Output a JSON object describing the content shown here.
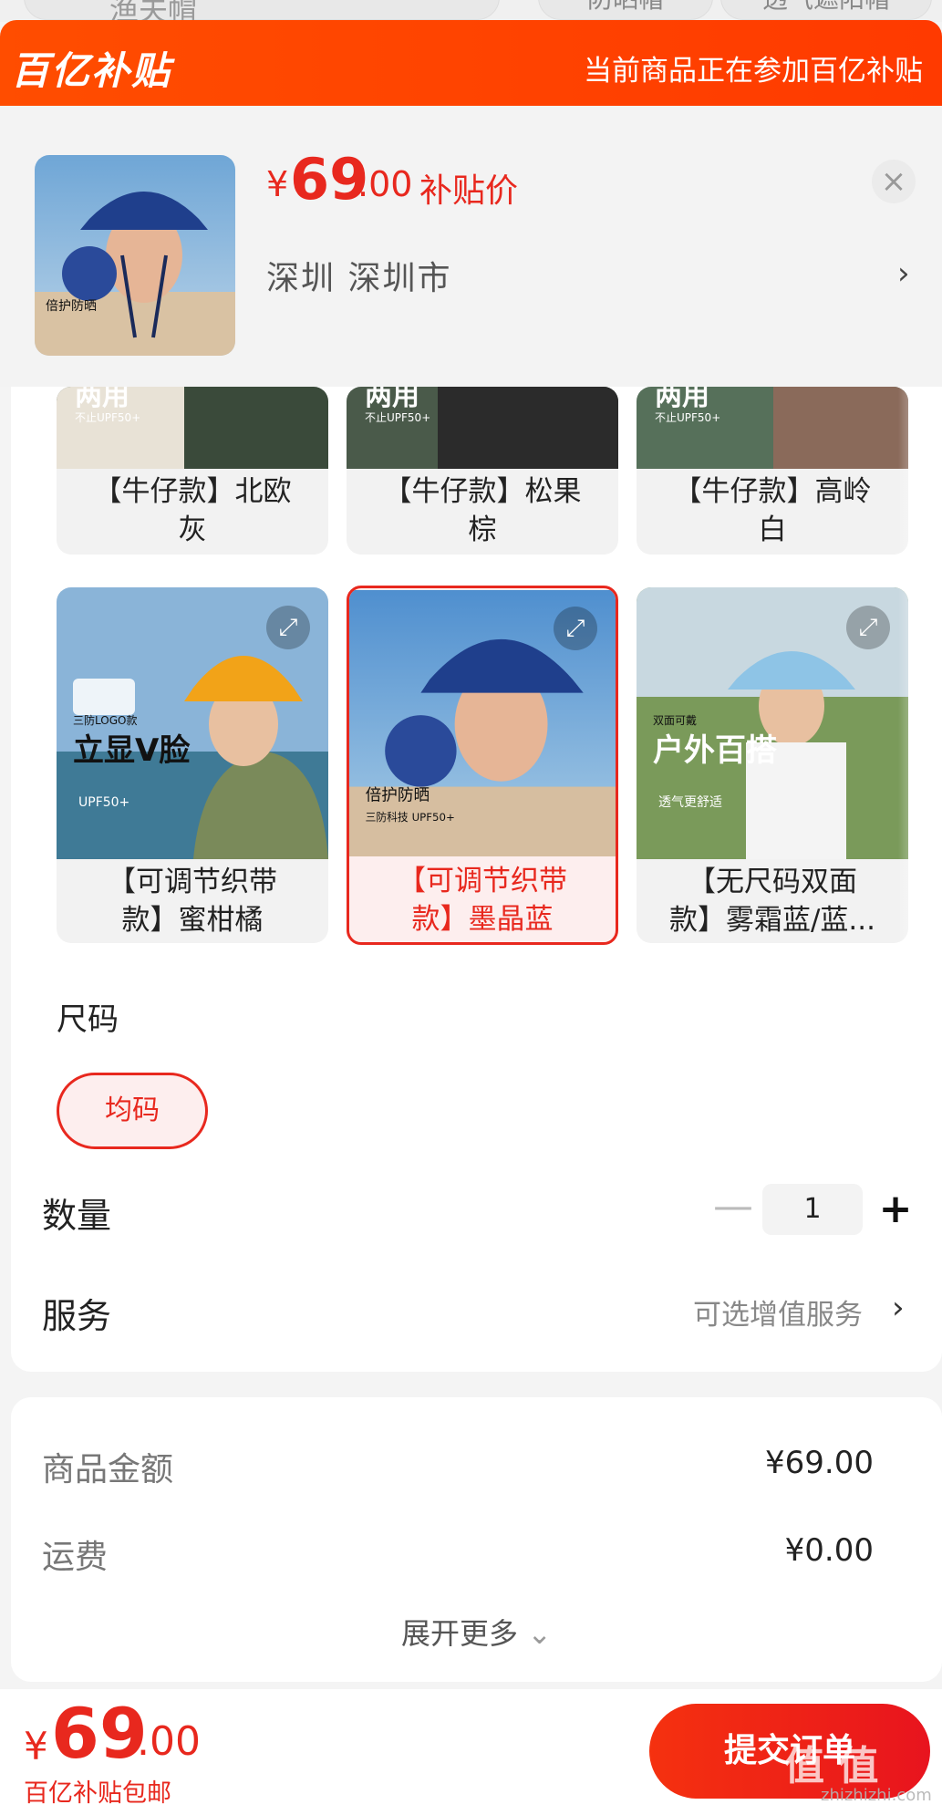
{
  "background": {
    "search_text": "渔夫帽",
    "chips": [
      "防晒帽",
      "透气遮阳帽"
    ]
  },
  "banner": {
    "logo": "百亿补贴",
    "message": "当前商品正在参加百亿补贴"
  },
  "product": {
    "thumb_caption": "倍护防晒",
    "price_symbol": "¥",
    "price_int": "69",
    "price_dec": ".00",
    "price_label": "补贴价",
    "address": "深圳  深圳市"
  },
  "variants": [
    {
      "label_line1": "【牛仔款】北欧",
      "label_line2": "灰",
      "overlay": "两用",
      "badge": "不止UPF50+",
      "selected": false
    },
    {
      "label_line1": "【牛仔款】松果",
      "label_line2": "棕",
      "overlay": "两用",
      "badge": "不止UPF50+",
      "selected": false
    },
    {
      "label_line1": "【牛仔款】高岭",
      "label_line2": "白",
      "overlay": "两用",
      "badge": "不止UPF50+",
      "selected": false
    },
    {
      "label_line1": "【可调节织带",
      "label_line2": "款】蜜柑橘",
      "overlay": "立显V脸",
      "badge": "UPF50+",
      "tag": "三防LOGO款",
      "selected": false
    },
    {
      "label_line1": "【可调节织带",
      "label_line2": "款】墨晶蓝",
      "overlay": "倍护防晒",
      "badge": "UPF50+",
      "tag": "三防科技",
      "selected": true
    },
    {
      "label_line1": "【无尺码双面",
      "label_line2": "款】雾霜蓝/蓝...",
      "overlay": "户外百搭",
      "badge": "透气更舒适",
      "tag": "双面可戴",
      "selected": false
    }
  ],
  "size": {
    "title": "尺码",
    "option": "均码"
  },
  "quantity": {
    "title": "数量",
    "value": "1",
    "minus": "—",
    "plus": "+"
  },
  "service": {
    "title": "服务",
    "value": "可选增值服务"
  },
  "summary": {
    "goods_label": "商品金额",
    "goods_value": "¥69.00",
    "shipping_label": "运费",
    "shipping_value": "¥0.00",
    "more": "展开更多"
  },
  "footer": {
    "price_symbol": "¥",
    "price_int": "69",
    "price_dec": ".00",
    "note": "百亿补贴包邮",
    "submit": "提交订单",
    "watermark": "值 值",
    "watermark_url": "zhizhizhi.com"
  },
  "colors": {
    "accent": "#e8281e",
    "banner": "#ff4a00"
  }
}
